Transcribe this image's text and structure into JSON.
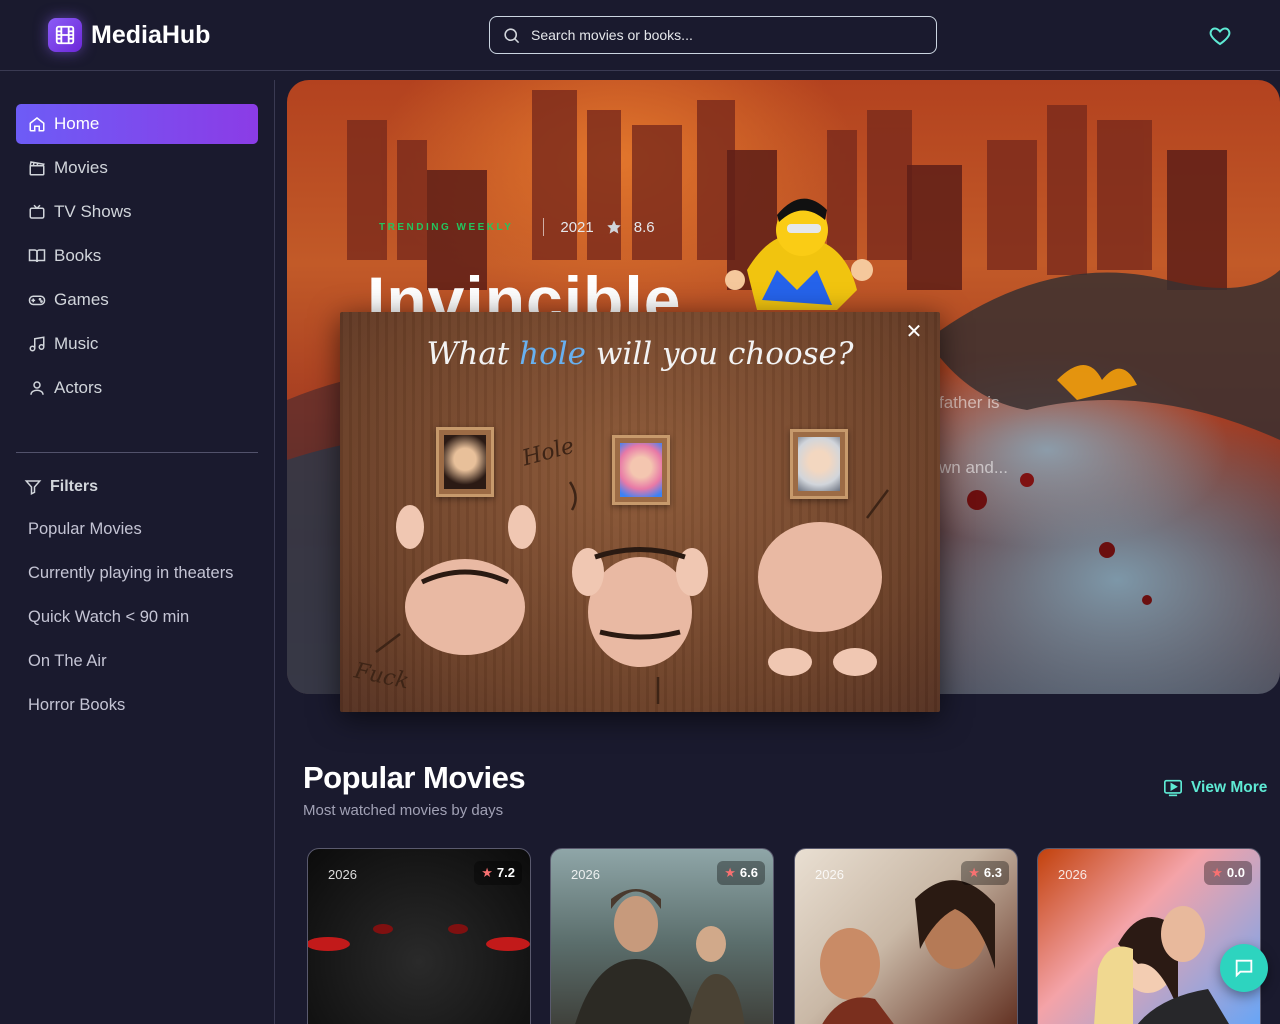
{
  "header": {
    "logo_text": "MediaHub",
    "search_placeholder": "Search movies or books..."
  },
  "sidebar": {
    "items": [
      {
        "label": "Home",
        "icon": "home-icon",
        "active": true
      },
      {
        "label": "Movies",
        "icon": "clapperboard-icon"
      },
      {
        "label": "TV Shows",
        "icon": "tv-icon"
      },
      {
        "label": "Books",
        "icon": "book-icon"
      },
      {
        "label": "Games",
        "icon": "gamepad-icon"
      },
      {
        "label": "Music",
        "icon": "music-icon"
      },
      {
        "label": "Actors",
        "icon": "user-icon"
      }
    ],
    "filters_title": "Filters",
    "filters": [
      "Popular Movies",
      "Currently playing in theaters",
      "Quick Watch < 90 min",
      "On The Air",
      "Horror Books"
    ]
  },
  "hero": {
    "badge": "TRENDING WEEKLY",
    "year": "2021",
    "rating": "8.6",
    "title": "Invincible",
    "desc_line1": "father is",
    "desc_line2": "wn and..."
  },
  "popup": {
    "title_before": "What ",
    "title_highlight": "hole",
    "title_after": " will you choose?",
    "scrawl_1": "Hole",
    "scrawl_2": "Fuck",
    "close_icon": "close-icon"
  },
  "popular": {
    "title": "Popular Movies",
    "subtitle": "Most watched movies by days",
    "view_more": "View More",
    "cards": [
      {
        "year": "2026",
        "rating": "7.2"
      },
      {
        "year": "2026",
        "rating": "6.6"
      },
      {
        "year": "2026",
        "rating": "6.3"
      },
      {
        "year": "2026",
        "rating": "0.0"
      }
    ]
  },
  "colors": {
    "background": "#1a1a2e",
    "accent": "#8b5cf6",
    "teal": "#2dd4bf",
    "trend_green": "#22c55e"
  }
}
